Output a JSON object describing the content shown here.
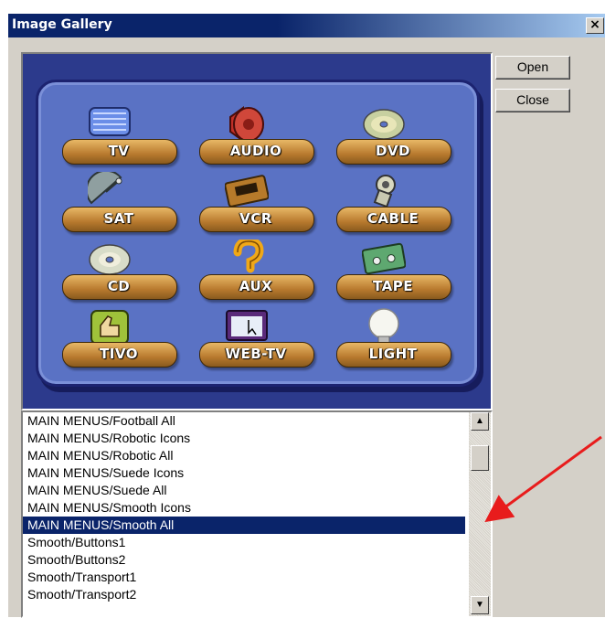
{
  "window": {
    "title": "Image Gallery",
    "close_label": "×"
  },
  "buttons": {
    "open": "Open",
    "close": "Close"
  },
  "preview": {
    "tiles": [
      {
        "label": "TV",
        "icon": "tv-icon"
      },
      {
        "label": "AUDIO",
        "icon": "speaker-icon"
      },
      {
        "label": "DVD",
        "icon": "disc-icon"
      },
      {
        "label": "SAT",
        "icon": "satellite-dish-icon"
      },
      {
        "label": "VCR",
        "icon": "vcr-tape-icon"
      },
      {
        "label": "CABLE",
        "icon": "cable-connector-icon"
      },
      {
        "label": "CD",
        "icon": "cd-icon"
      },
      {
        "label": "AUX",
        "icon": "question-mark-icon"
      },
      {
        "label": "TAPE",
        "icon": "cassette-icon"
      },
      {
        "label": "TIVO",
        "icon": "thumbs-up-icon"
      },
      {
        "label": "WEB-TV",
        "icon": "browser-window-icon"
      },
      {
        "label": "LIGHT",
        "icon": "light-bulb-icon"
      }
    ]
  },
  "list": {
    "items": [
      "MAIN MENUS/Football All",
      "MAIN MENUS/Robotic Icons",
      "MAIN MENUS/Robotic All",
      "MAIN MENUS/Suede Icons",
      "MAIN MENUS/Suede All",
      "MAIN MENUS/Smooth Icons",
      "MAIN MENUS/Smooth All",
      "Smooth/Buttons1",
      "Smooth/Buttons2",
      "Smooth/Transport1",
      "Smooth/Transport2"
    ],
    "selected_index": 6
  },
  "colors": {
    "accent": "#0a246a",
    "annotation_arrow": "#e81c1c"
  }
}
